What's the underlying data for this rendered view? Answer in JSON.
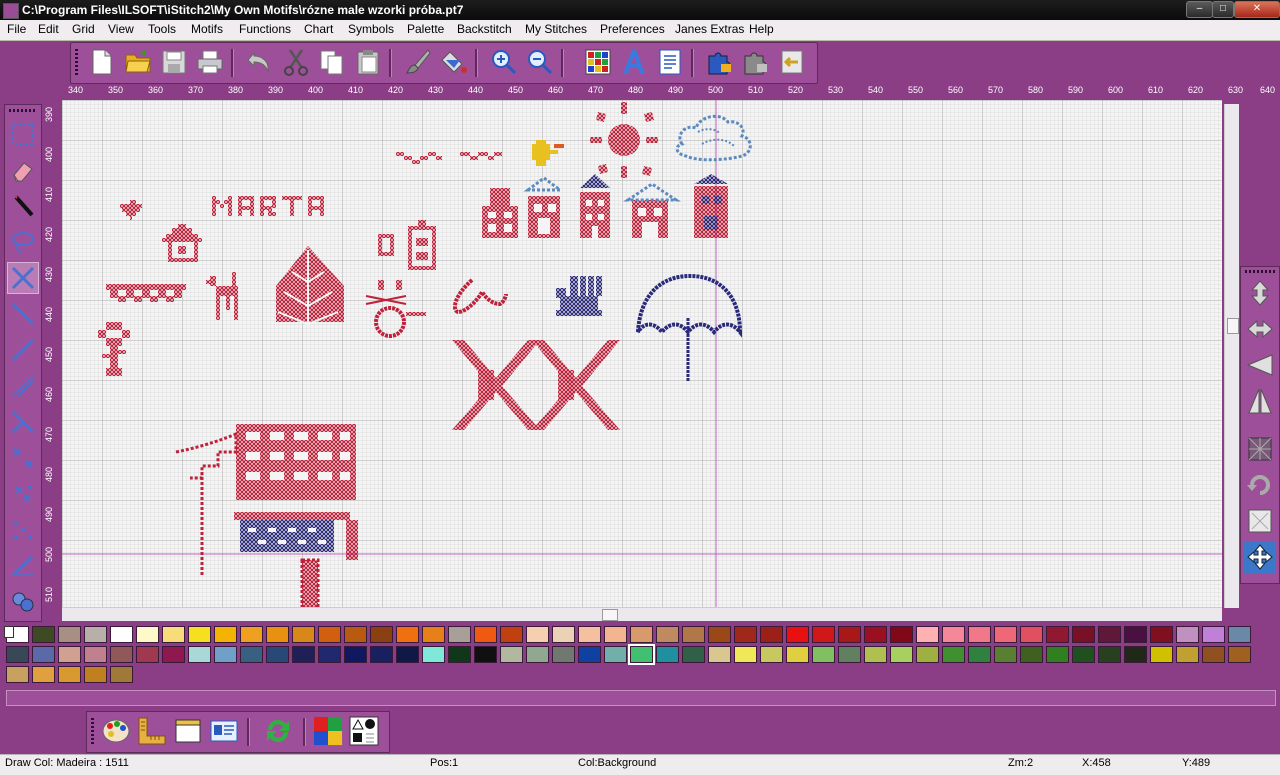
{
  "window": {
    "title": "C:\\Program Files\\ILSOFT\\iStitch2\\My Own Motifs\\rózne male wzorki próba.pt7",
    "buttons": [
      "minimize",
      "maximize",
      "close"
    ]
  },
  "menu": [
    "File",
    "Edit",
    "Grid",
    "View",
    "Tools",
    "Motifs",
    "Functions",
    "Chart",
    "Symbols",
    "Palette",
    "Backstitch",
    "My Stitches",
    "Preferences",
    "Janes Extras",
    "Help"
  ],
  "toolbar": {
    "icons": [
      "new-document-icon",
      "open-folder-icon",
      "save-icon",
      "print-icon",
      "undo-icon",
      "scissors-icon",
      "copy-icon",
      "paste-icon",
      "brush-icon",
      "fill-icon",
      "zoom-in-icon",
      "zoom-out-icon",
      "grid-icon",
      "text-icon",
      "page-icon",
      "puzzle-icon",
      "puzzle-gray-icon",
      "import-icon"
    ]
  },
  "rulers": {
    "horizontal": [
      "340",
      "350",
      "360",
      "370",
      "380",
      "390",
      "400",
      "410",
      "420",
      "430",
      "440",
      "450",
      "460",
      "470",
      "480",
      "490",
      "500",
      "510",
      "520",
      "530",
      "540",
      "550",
      "560",
      "570",
      "580",
      "590",
      "600",
      "610",
      "620",
      "630",
      "640"
    ],
    "vertical": [
      "390",
      "400",
      "410",
      "420",
      "430",
      "440",
      "450",
      "460",
      "470",
      "480",
      "490",
      "500",
      "510"
    ]
  },
  "colors": {
    "chrome": "#8b3d86",
    "panel": "#9e4f9a",
    "grid_bg": "#f4f4f4",
    "stitch_red": "#c0203a",
    "stitch_navy": "#2a2a7a",
    "stitch_blue": "#5a8ac0",
    "stitch_yellow": "#e8c020",
    "stitch_orange": "#e05a20"
  },
  "palette": {
    "selected_index": 72,
    "swatches": [
      "#ffffff",
      "#3d4a24",
      "#a78f83",
      "#b8b0a8",
      "#ffffff",
      "#fff8c8",
      "#f7dc7a",
      "#f5e020",
      "#f2b400",
      "#f0a020",
      "#e89010",
      "#d88818",
      "#d06010",
      "#b85a10",
      "#8a4010",
      "#f07010",
      "#e8801a",
      "#a8a098",
      "#f05a10",
      "#c04010",
      "#f5d0b0",
      "#ebd2b5",
      "#f5c0a0",
      "#f3b590",
      "#d89a6a",
      "#c08a60",
      "#b07848",
      "#9a4818",
      "#a02818",
      "#9a2018",
      "#e81010",
      "#d01818",
      "#a81818",
      "#9a1020",
      "#800818",
      "#ffb0b0",
      "#f58898",
      "#f07888",
      "#ee6878",
      "#e05060",
      "#901830",
      "#781028",
      "#601838",
      "#4a1040",
      "#801020",
      "#c090c0",
      "#c080d8",
      "#6a88a8",
      "#384858",
      "#5a6aa8",
      "#d0a090",
      "#c08090",
      "#905858",
      "#a03850",
      "#901850",
      "#a8d8d8",
      "#70a0c8",
      "#386080",
      "#284878",
      "#202058",
      "#202870",
      "#101860",
      "#182060",
      "#101848",
      "#80e8d8",
      "#103818",
      "#101010",
      "#b0b8a0",
      "#90a890",
      "#707870",
      "#1040a0",
      "#70b0a8",
      "#40c070",
      "#2090a0",
      "#306048",
      "#d8c890",
      "#f0e858",
      "#c8c860",
      "#e0d040",
      "#80c060",
      "#608060",
      "#b0c050",
      "#a8d060",
      "#a0b040",
      "#409030",
      "#308040",
      "#588030",
      "#406020",
      "#308020",
      "#205020",
      "#284020",
      "#202818",
      "#d0c000",
      "#c0a030",
      "#905020",
      "#a06020",
      "#c8a060",
      "#e0a040",
      "#d89a30",
      "#c08020",
      "#a07838"
    ]
  },
  "status": {
    "draw_col": "Draw Col: Madeira : 1511",
    "pos": "Pos:1",
    "col": "Col:Background",
    "zoom": "Zm:2",
    "x": "X:458",
    "y": "Y:489"
  }
}
